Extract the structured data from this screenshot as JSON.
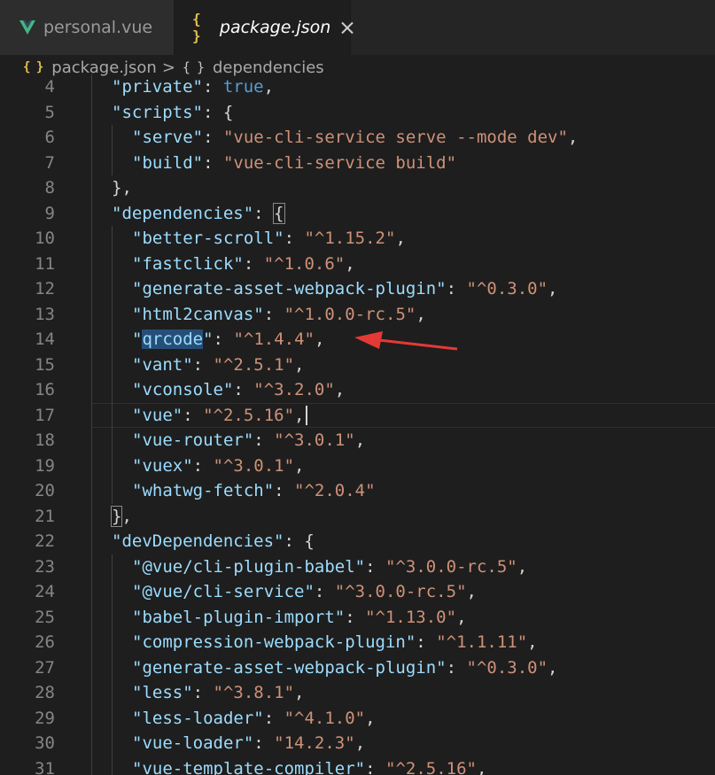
{
  "tabs": [
    {
      "label": "personal.vue",
      "icon": "vue-icon",
      "active": false
    },
    {
      "label": "package.json",
      "icon": "json-icon",
      "active": true
    }
  ],
  "breadcrumb": {
    "file": "package.json",
    "separator": ">",
    "section_icon": "{ }",
    "section": "dependencies"
  },
  "json_icon_glyph": "{ }",
  "annotation": {
    "type": "arrow",
    "color": "#e53935",
    "points_to_line": 14
  },
  "code_lines": [
    {
      "n": "4",
      "indent": 1,
      "key": "\"private\"",
      "sep": ": ",
      "value": "true",
      "value_type": "bool",
      "tail": ","
    },
    {
      "n": "5",
      "indent": 1,
      "key": "\"scripts\"",
      "sep": ": ",
      "value": "",
      "value_type": "",
      "tail": "{"
    },
    {
      "n": "6",
      "indent": 2,
      "key": "\"serve\"",
      "sep": ": ",
      "value": "\"vue-cli-service serve --mode dev\"",
      "value_type": "string",
      "tail": ","
    },
    {
      "n": "7",
      "indent": 2,
      "key": "\"build\"",
      "sep": ": ",
      "value": "\"vue-cli-service build\"",
      "value_type": "string",
      "tail": ""
    },
    {
      "n": "8",
      "indent": 1,
      "key": "",
      "sep": "",
      "value": "",
      "value_type": "",
      "tail": "},"
    },
    {
      "n": "9",
      "indent": 1,
      "key": "\"dependencies\"",
      "sep": ": ",
      "value": "",
      "value_type": "",
      "tail": "{"
    },
    {
      "n": "10",
      "indent": 2,
      "key": "\"better-scroll\"",
      "sep": ": ",
      "value": "\"^1.15.2\"",
      "value_type": "string",
      "tail": ","
    },
    {
      "n": "11",
      "indent": 2,
      "key": "\"fastclick\"",
      "sep": ": ",
      "value": "\"^1.0.6\"",
      "value_type": "string",
      "tail": ","
    },
    {
      "n": "12",
      "indent": 2,
      "key": "\"generate-asset-webpack-plugin\"",
      "sep": ": ",
      "value": "\"^0.3.0\"",
      "value_type": "string",
      "tail": ","
    },
    {
      "n": "13",
      "indent": 2,
      "key": "\"html2canvas\"",
      "sep": ": ",
      "value": "\"^1.0.0-rc.5\"",
      "value_type": "string",
      "tail": ","
    },
    {
      "n": "14",
      "indent": 2,
      "key": "\"qrcode\"",
      "sep": ": ",
      "value": "\"^1.4.4\"",
      "value_type": "string",
      "tail": ","
    },
    {
      "n": "15",
      "indent": 2,
      "key": "\"vant\"",
      "sep": ": ",
      "value": "\"^2.5.1\"",
      "value_type": "string",
      "tail": ","
    },
    {
      "n": "16",
      "indent": 2,
      "key": "\"vconsole\"",
      "sep": ": ",
      "value": "\"^3.2.0\"",
      "value_type": "string",
      "tail": ","
    },
    {
      "n": "17",
      "indent": 2,
      "key": "\"vue\"",
      "sep": ": ",
      "value": "\"^2.5.16\"",
      "value_type": "string",
      "tail": ","
    },
    {
      "n": "18",
      "indent": 2,
      "key": "\"vue-router\"",
      "sep": ": ",
      "value": "\"^3.0.1\"",
      "value_type": "string",
      "tail": ","
    },
    {
      "n": "19",
      "indent": 2,
      "key": "\"vuex\"",
      "sep": ": ",
      "value": "\"^3.0.1\"",
      "value_type": "string",
      "tail": ","
    },
    {
      "n": "20",
      "indent": 2,
      "key": "\"whatwg-fetch\"",
      "sep": ": ",
      "value": "\"^2.0.4\"",
      "value_type": "string",
      "tail": ""
    },
    {
      "n": "21",
      "indent": 1,
      "key": "",
      "sep": "",
      "value": "",
      "value_type": "",
      "tail": "},"
    },
    {
      "n": "22",
      "indent": 1,
      "key": "\"devDependencies\"",
      "sep": ": ",
      "value": "",
      "value_type": "",
      "tail": "{"
    },
    {
      "n": "23",
      "indent": 2,
      "key": "\"@vue/cli-plugin-babel\"",
      "sep": ": ",
      "value": "\"^3.0.0-rc.5\"",
      "value_type": "string",
      "tail": ","
    },
    {
      "n": "24",
      "indent": 2,
      "key": "\"@vue/cli-service\"",
      "sep": ": ",
      "value": "\"^3.0.0-rc.5\"",
      "value_type": "string",
      "tail": ","
    },
    {
      "n": "25",
      "indent": 2,
      "key": "\"babel-plugin-import\"",
      "sep": ": ",
      "value": "\"^1.13.0\"",
      "value_type": "string",
      "tail": ","
    },
    {
      "n": "26",
      "indent": 2,
      "key": "\"compression-webpack-plugin\"",
      "sep": ": ",
      "value": "\"^1.1.11\"",
      "value_type": "string",
      "tail": ","
    },
    {
      "n": "27",
      "indent": 2,
      "key": "\"generate-asset-webpack-plugin\"",
      "sep": ": ",
      "value": "\"^0.3.0\"",
      "value_type": "string",
      "tail": ","
    },
    {
      "n": "28",
      "indent": 2,
      "key": "\"less\"",
      "sep": ": ",
      "value": "\"^3.8.1\"",
      "value_type": "string",
      "tail": ","
    },
    {
      "n": "29",
      "indent": 2,
      "key": "\"less-loader\"",
      "sep": ": ",
      "value": "\"^4.1.0\"",
      "value_type": "string",
      "tail": ","
    },
    {
      "n": "30",
      "indent": 2,
      "key": "\"vue-loader\"",
      "sep": ": ",
      "value": "\"14.2.3\"",
      "value_type": "string",
      "tail": ","
    },
    {
      "n": "31",
      "indent": 2,
      "key": "\"vue-template-compiler\"",
      "sep": ": ",
      "value": "\"^2.5.16\"",
      "value_type": "string",
      "tail": ","
    }
  ]
}
